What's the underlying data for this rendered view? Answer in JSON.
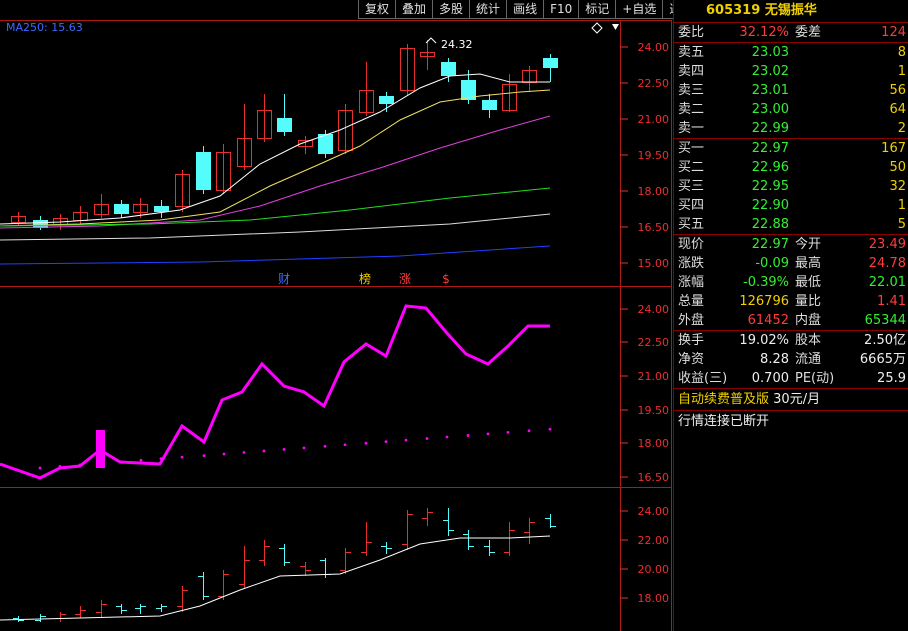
{
  "toolbar": {
    "items": [
      "复权",
      "叠加",
      "多股",
      "统计",
      "画线",
      "F10",
      "标记",
      "+自选",
      "返回"
    ]
  },
  "ma_label": "MA250: 15.63",
  "annotations": {
    "peak_label": "24.32",
    "marker1": "财",
    "marker2": "榜",
    "marker3": "涨",
    "marker4": "$"
  },
  "axes": {
    "main": [
      "24.00",
      "22.50",
      "21.00",
      "19.50",
      "18.00",
      "16.50",
      "15.00"
    ],
    "mid": [
      "24.00",
      "22.50",
      "21.00",
      "19.50",
      "18.00",
      "16.50"
    ],
    "low": [
      "24.00",
      "22.00",
      "20.00",
      "18.00"
    ]
  },
  "panel": {
    "code": "605319",
    "name": "无锡振华",
    "weibi": {
      "label": "委比",
      "value": "32.12%",
      "label2": "委差",
      "value2": "124"
    },
    "asks": [
      {
        "label": "卖五",
        "price": "23.03",
        "vol": "8"
      },
      {
        "label": "卖四",
        "price": "23.02",
        "vol": "1"
      },
      {
        "label": "卖三",
        "price": "23.01",
        "vol": "56"
      },
      {
        "label": "卖二",
        "price": "23.00",
        "vol": "64"
      },
      {
        "label": "卖一",
        "price": "22.99",
        "vol": "2"
      }
    ],
    "bids": [
      {
        "label": "买一",
        "price": "22.97",
        "vol": "167"
      },
      {
        "label": "买二",
        "price": "22.96",
        "vol": "50"
      },
      {
        "label": "买三",
        "price": "22.95",
        "vol": "32"
      },
      {
        "label": "买四",
        "price": "22.90",
        "vol": "1"
      },
      {
        "label": "买五",
        "price": "22.88",
        "vol": "5"
      }
    ],
    "stats": [
      {
        "l1": "现价",
        "v1": "22.97",
        "l2": "今开",
        "v2": "23.49"
      },
      {
        "l1": "涨跌",
        "v1": "-0.09",
        "l2": "最高",
        "v2": "24.78"
      },
      {
        "l1": "涨幅",
        "v1": "-0.39%",
        "l2": "最低",
        "v2": "22.01"
      },
      {
        "l1": "总量",
        "v1": "126796",
        "l2": "量比",
        "v2": "1.41"
      },
      {
        "l1": "外盘",
        "v1": "61452",
        "l2": "内盘",
        "v2": "65344"
      }
    ],
    "stats2": [
      {
        "l1": "换手",
        "v1": "19.02%",
        "l2": "股本",
        "v2": "2.50亿"
      },
      {
        "l1": "净资",
        "v1": "8.28",
        "l2": "流通",
        "v2": "6665万"
      },
      {
        "l1": "收益(三)",
        "v1": "0.700",
        "l2": "PE(动)",
        "v2": "25.9"
      }
    ],
    "promo": {
      "text": "自动续费普及版",
      "price": "30元/月"
    },
    "status": "行情连接已断开"
  }
}
